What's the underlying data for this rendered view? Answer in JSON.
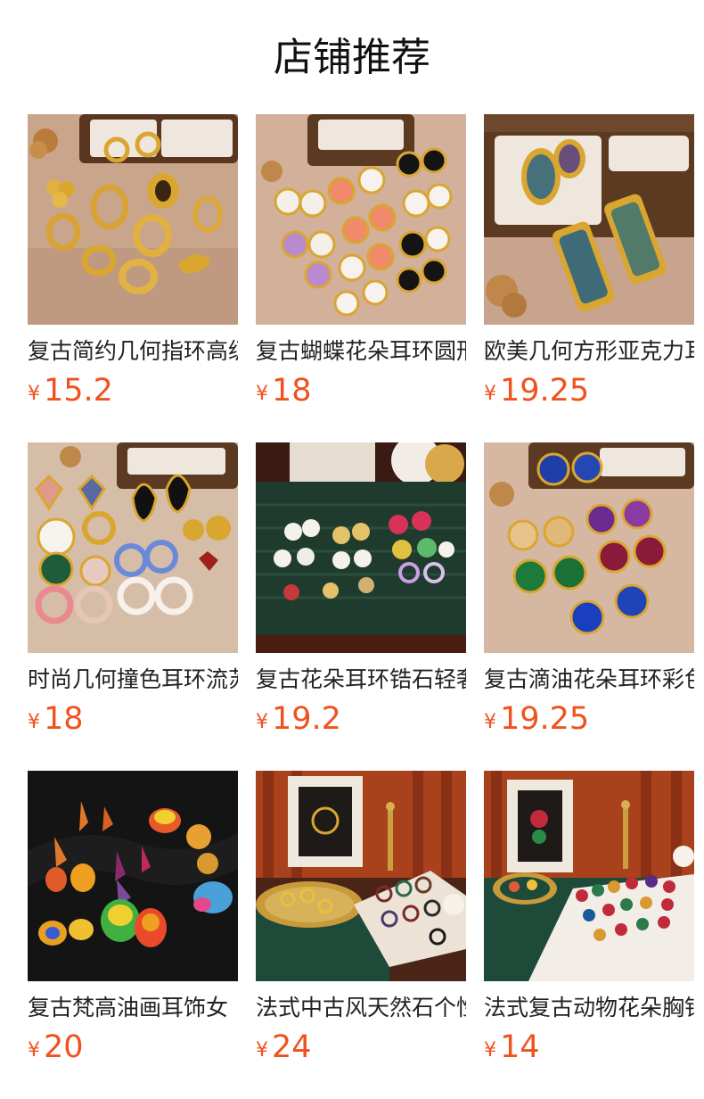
{
  "section": {
    "title": "店铺推荐"
  },
  "currency_symbol": "¥",
  "accent_color": "#f0521f",
  "products": [
    {
      "name": "复古简约几何指环高级",
      "price": "15.2",
      "photo": "gold-rings"
    },
    {
      "name": "复古蝴蝶花朵耳环圆形",
      "price": "18",
      "photo": "enamel-flower-studs"
    },
    {
      "name": "欧美几何方形亚克力耳",
      "price": "19.25",
      "photo": "abalone-earrings"
    },
    {
      "name": "时尚几何撞色耳环流苏",
      "price": "18",
      "photo": "colorblock-earrings"
    },
    {
      "name": "复古花朵耳环锆石轻奢",
      "price": "19.2",
      "photo": "zircon-flower-earrings"
    },
    {
      "name": "复古滴油花朵耳环彩色",
      "price": "19.25",
      "photo": "drip-oil-flower-earrings"
    },
    {
      "name": "复古梵高油画耳饰女",
      "price": "20",
      "photo": "oil-painting-earrings"
    },
    {
      "name": "法式中古风天然石个性",
      "price": "24",
      "photo": "natural-stone-rings"
    },
    {
      "name": "法式复古动物花朵胸针",
      "price": "14",
      "photo": "animal-flower-brooches"
    }
  ]
}
